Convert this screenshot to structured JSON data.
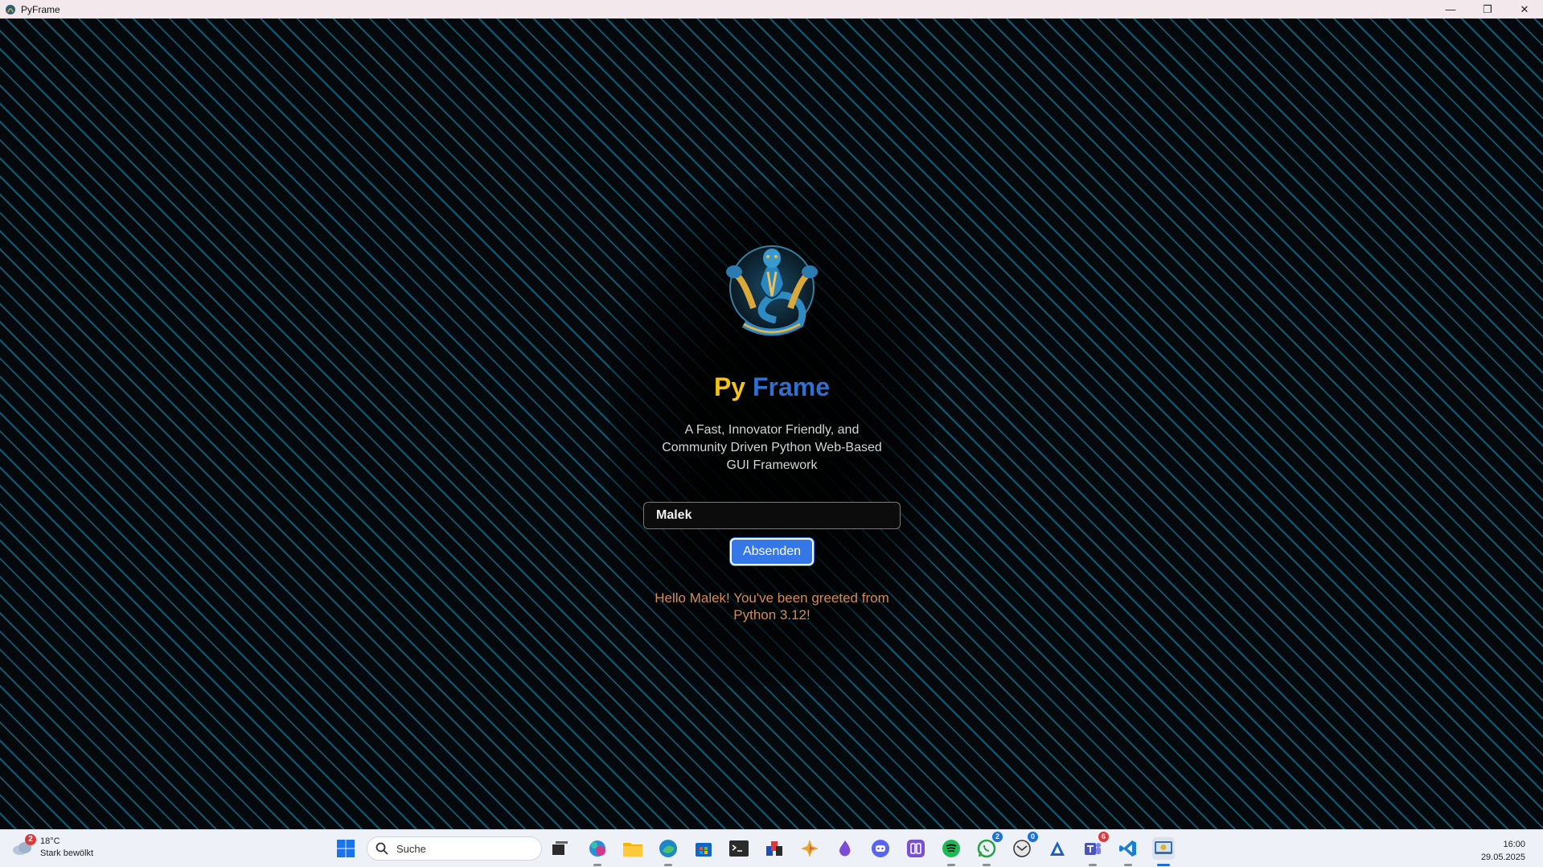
{
  "window": {
    "title": "PyFrame",
    "minimize": "—",
    "restore": "❐",
    "close": "✕"
  },
  "app": {
    "brand_py": "Py",
    "brand_frame": "Frame",
    "tagline": "A Fast, Innovator Friendly, and Community Driven Python Web-Based GUI Framework",
    "input_value": "Malek",
    "submit_label": "Absenden",
    "greeting": "Hello Malek! You've been greeted from Python 3.12!"
  },
  "taskbar": {
    "weather_temp": "18°C",
    "weather_desc": "Stark bewölkt",
    "weather_badge": "2",
    "search_placeholder": "Suche",
    "icons": [
      {
        "name": "task-view-icon",
        "color": "#2b2b2b"
      },
      {
        "name": "m365-copilot-icon",
        "color": "#2a8fd8"
      },
      {
        "name": "file-explorer-icon",
        "color": "#f4b400"
      },
      {
        "name": "edge-browser-icon",
        "color": "#1e88c7"
      },
      {
        "name": "microsoft-store-icon",
        "color": "#1565c0"
      },
      {
        "name": "terminal-icon",
        "color": "#2b2b2b"
      },
      {
        "name": "color-blocks-app-icon",
        "color": "#d83b3b"
      },
      {
        "name": "sparkle-app-icon",
        "color": "#e6a62c"
      },
      {
        "name": "purple-drop-app-icon",
        "color": "#7d4bd6"
      },
      {
        "name": "discord-icon",
        "color": "#5865f2"
      },
      {
        "name": "purple-app-icon",
        "color": "#7a4fd8"
      },
      {
        "name": "spotify-icon",
        "color": "#1db954"
      },
      {
        "name": "whatsapp-icon",
        "color": "#25a244"
      },
      {
        "name": "mail-client-icon",
        "color": "#333333"
      },
      {
        "name": "vpn-app-icon",
        "color": "#1e60c6"
      },
      {
        "name": "teams-icon",
        "color": "#4b53bc"
      },
      {
        "name": "vscode-icon",
        "color": "#1b7fd0"
      },
      {
        "name": "pyframe-taskbar-icon",
        "color": "#3a6ea5"
      }
    ],
    "badges": {
      "whatsapp": "2",
      "mail": "0",
      "teams": "6"
    },
    "time": "16:00",
    "date": "29.05.2025"
  }
}
